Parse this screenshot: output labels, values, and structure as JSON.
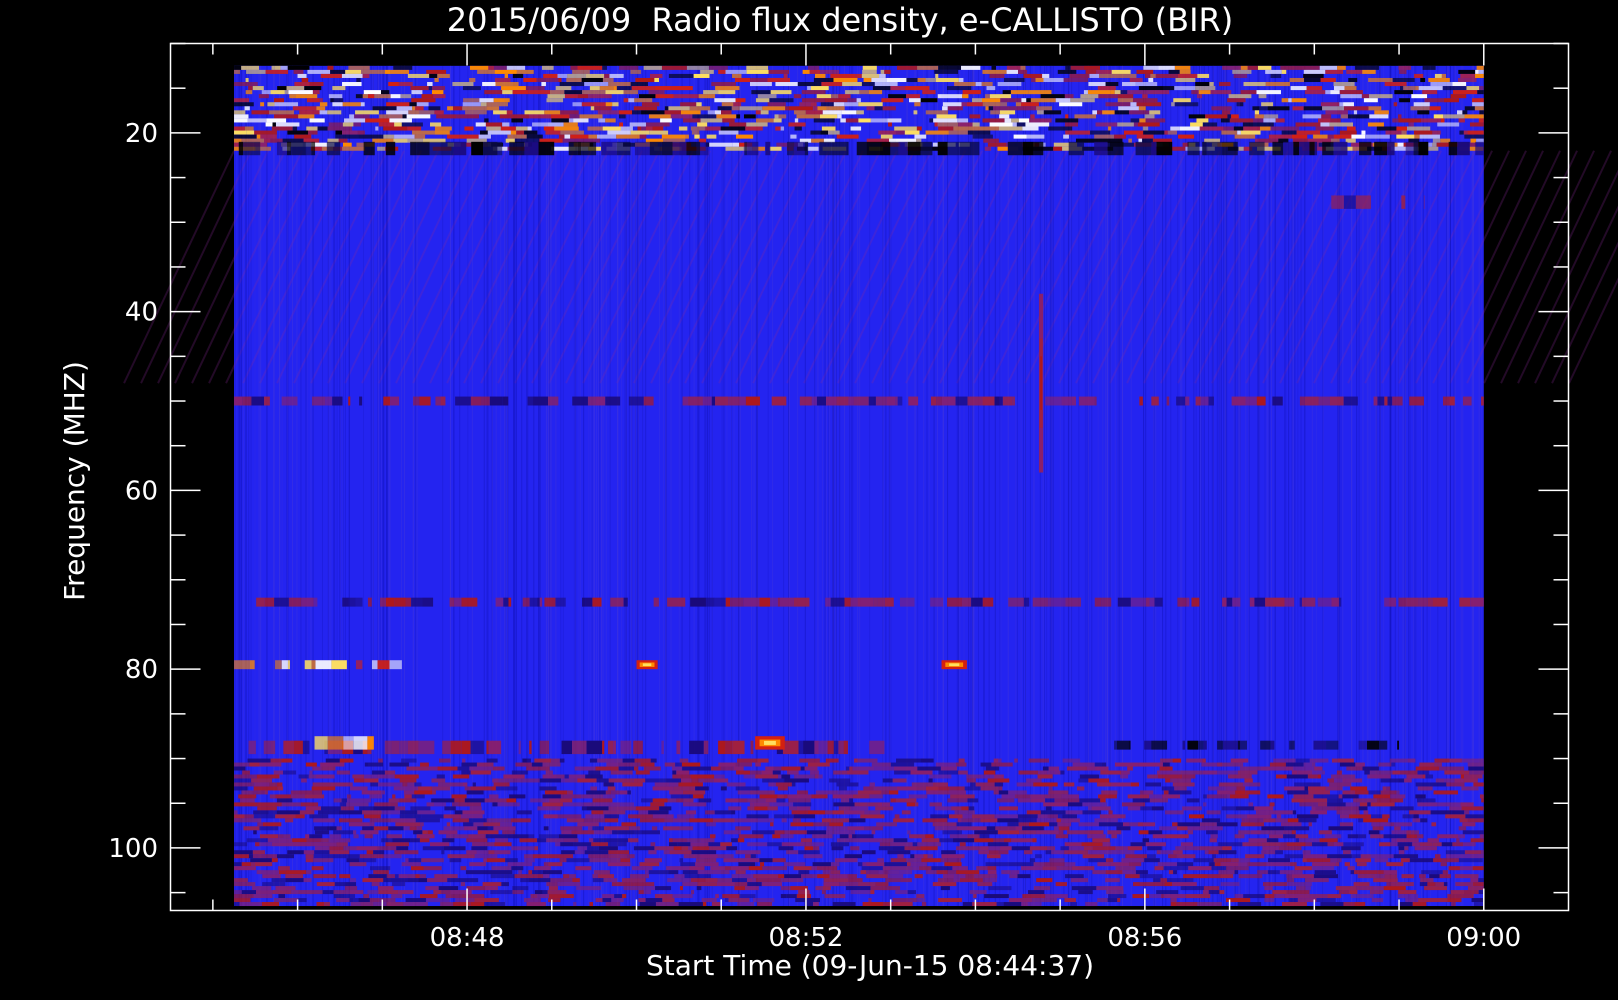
{
  "chart_data": {
    "type": "heatmap",
    "title": "2015/06/09  Radio flux density, e-CALLISTO (BIR)",
    "xlabel": "Start Time (09-Jun-15 08:44:37)",
    "ylabel": "Frequency (MHZ)",
    "x_range": [
      "08:44:37",
      "09:00:00"
    ],
    "xlim_minutes": [
      8.5,
      25.0
    ],
    "ylim": [
      10,
      107
    ],
    "y_axis_inverted": true,
    "x_ticks": [
      {
        "label": "08:48",
        "minutes": 12
      },
      {
        "label": "08:52",
        "minutes": 16
      },
      {
        "label": "08:56",
        "minutes": 20
      },
      {
        "label": "09:00",
        "minutes": 24
      }
    ],
    "x_minor_minutes": [
      9,
      10,
      11,
      13,
      14,
      15,
      17,
      18,
      19,
      21,
      22,
      23
    ],
    "y_ticks": [
      {
        "label": "20",
        "value": 20
      },
      {
        "label": "40",
        "value": 40
      },
      {
        "label": "60",
        "value": 60
      },
      {
        "label": "80",
        "value": 80
      },
      {
        "label": "100",
        "value": 100
      }
    ],
    "y_minor": [
      10,
      15,
      25,
      30,
      35,
      45,
      50,
      55,
      65,
      70,
      75,
      85,
      90,
      95,
      105
    ],
    "data_extent": {
      "t_start": 9.25,
      "t_end": 24.0,
      "f_top": 12.5,
      "f_bottom": 106.5
    },
    "colormap": [
      "#000000",
      "#1a0a7a",
      "#2828ff",
      "#8a1f6a",
      "#d42010",
      "#ff8a00",
      "#ffe060",
      "#ffffff"
    ],
    "background_color": "#2424f0",
    "features": [
      {
        "desc": "intermittent interference band",
        "f_min": 12.5,
        "f_max": 22,
        "t_start": 9.25,
        "t_end": 24.0,
        "intensity": "high"
      },
      {
        "desc": "dark band",
        "f_min": 21,
        "f_max": 22.5,
        "t_start": 9.25,
        "t_end": 24.0,
        "intensity": "low"
      },
      {
        "desc": "faint band",
        "f_min": 49.5,
        "f_max": 50.5,
        "t_start": 9.25,
        "t_end": 24.0,
        "intensity": "medium"
      },
      {
        "desc": "spike",
        "f_min": 38,
        "f_max": 58,
        "t_start": 18.75,
        "t_end": 18.8,
        "intensity": "medium"
      },
      {
        "desc": "faint band",
        "f_min": 72,
        "f_max": 73,
        "t_start": 9.25,
        "t_end": 24.0,
        "intensity": "medium"
      },
      {
        "desc": "bursts",
        "f_min": 79,
        "f_max": 80,
        "t_start": 9.25,
        "t_end": 11.3,
        "intensity": "high"
      },
      {
        "desc": "bursts",
        "f_min": 79,
        "f_max": 80,
        "t_start": 14.0,
        "t_end": 14.25,
        "intensity": "high"
      },
      {
        "desc": "bursts",
        "f_min": 79,
        "f_max": 80,
        "t_start": 17.6,
        "t_end": 17.9,
        "intensity": "high"
      },
      {
        "desc": "band",
        "f_min": 88,
        "f_max": 89.5,
        "t_start": 9.25,
        "t_end": 17.0,
        "intensity": "medium"
      },
      {
        "desc": "burst",
        "f_min": 87.5,
        "f_max": 89,
        "t_start": 15.4,
        "t_end": 15.75,
        "intensity": "high"
      },
      {
        "desc": "burst",
        "f_min": 87.5,
        "f_max": 89,
        "t_start": 10.2,
        "t_end": 10.9,
        "intensity": "high"
      },
      {
        "desc": "interference region",
        "f_min": 90,
        "f_max": 106.5,
        "t_start": 9.25,
        "t_end": 24.0,
        "intensity": "medium"
      },
      {
        "desc": "dark band",
        "f_min": 88,
        "f_max": 89,
        "t_start": 19.5,
        "t_end": 23.0,
        "intensity": "low"
      },
      {
        "desc": "bursts",
        "f_min": 27,
        "f_max": 28.5,
        "t_start": 22.2,
        "t_end": 23.3,
        "intensity": "medium"
      }
    ]
  }
}
